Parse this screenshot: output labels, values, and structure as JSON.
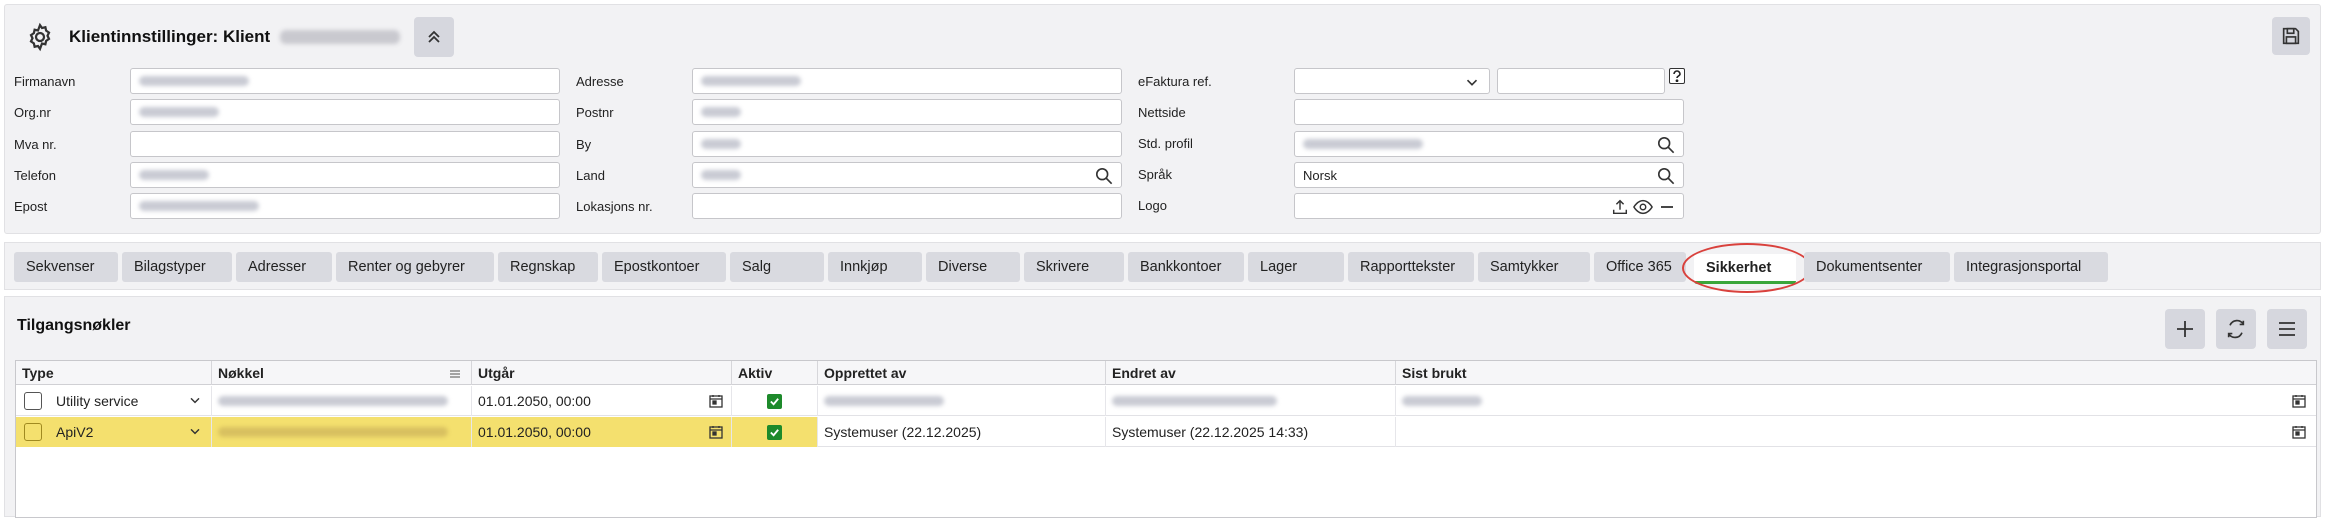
{
  "header": {
    "title": "Klientinnstillinger: Klient"
  },
  "form": {
    "firmanavn_label": "Firmanavn",
    "orgnr_label": "Org.nr",
    "mva_label": "Mva nr.",
    "telefon_label": "Telefon",
    "epost_label": "Epost",
    "adresse_label": "Adresse",
    "postnr_label": "Postnr",
    "by_label": "By",
    "land_label": "Land",
    "lokasjon_label": "Lokasjons nr.",
    "efaktura_label": "eFaktura ref.",
    "nettside_label": "Nettside",
    "stdprofil_label": "Std. profil",
    "sprak_label": "Språk",
    "sprak_value": "Norsk",
    "logo_label": "Logo"
  },
  "tabs": [
    {
      "label": "Sekvenser"
    },
    {
      "label": "Bilagstyper"
    },
    {
      "label": "Adresser"
    },
    {
      "label": "Renter og gebyrer"
    },
    {
      "label": "Regnskap"
    },
    {
      "label": "Epostkontoer"
    },
    {
      "label": "Salg"
    },
    {
      "label": "Innkjøp"
    },
    {
      "label": "Diverse"
    },
    {
      "label": "Skrivere"
    },
    {
      "label": "Bankkontoer"
    },
    {
      "label": "Lager"
    },
    {
      "label": "Rapporttekster"
    },
    {
      "label": "Samtykker"
    },
    {
      "label": "Office 365"
    },
    {
      "label": "Sikkerhet"
    },
    {
      "label": "Dokumentsenter"
    },
    {
      "label": "Integrasjonsportal"
    }
  ],
  "active_tab": "Sikkerhet",
  "grid": {
    "title": "Tilgangsnøkler",
    "columns": [
      "Type",
      "Nøkkel",
      "Utgår",
      "Aktiv",
      "Opprettet av",
      "Endret av",
      "Sist brukt"
    ],
    "rows": [
      {
        "type": "Utility service",
        "utgar": "01.01.2050, 00:00",
        "aktiv": true,
        "opprettet": "",
        "endret": "",
        "sist": ""
      },
      {
        "type": "ApiV2",
        "utgar": "01.01.2050, 00:00",
        "aktiv": true,
        "opprettet": "Systemuser (22.12.2025)",
        "endret": "Systemuser (22.12.2025 14:33)",
        "sist": ""
      }
    ]
  },
  "colors": {
    "selected_row": "#f4e06e",
    "active_check": "#1d8a2b",
    "highlight_ring": "#d9413c",
    "active_tab_underline": "#3aa63a"
  }
}
